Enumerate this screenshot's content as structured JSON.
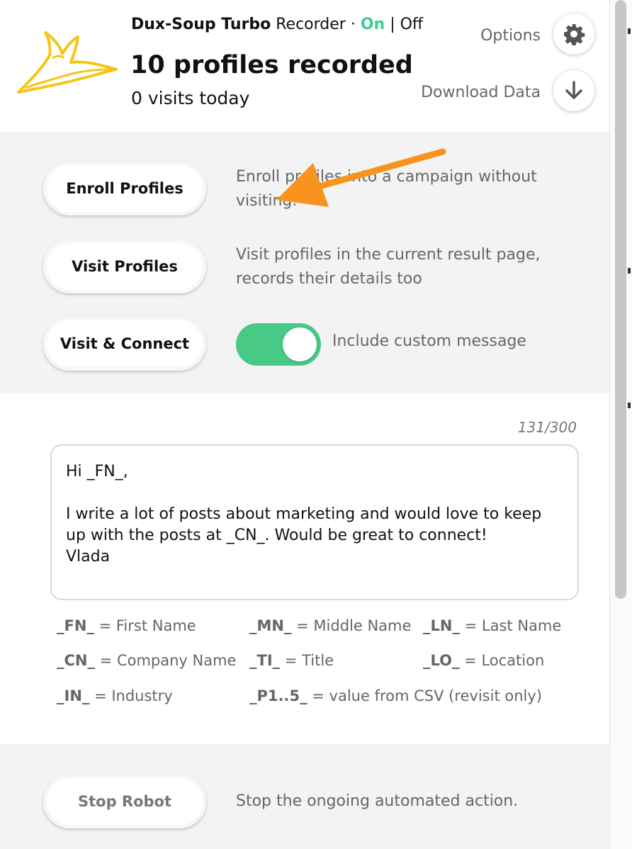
{
  "header": {
    "brand_name": "Dux-Soup Turbo",
    "brand_suffix": " Recorder · ",
    "on_label": "On",
    "separator": " | ",
    "off_label": "Off",
    "title": "10 profiles recorded",
    "subtitle": "0 visits today",
    "options_label": "Options",
    "download_label": "Download Data"
  },
  "actions": [
    {
      "label": "Enroll Profiles",
      "description": "Enroll profiles into a campaign without visiting."
    },
    {
      "label": "Visit Profiles",
      "description": "Visit profiles in the current result page, records their details too"
    },
    {
      "label": "Visit & Connect"
    }
  ],
  "toggle": {
    "label": "Include custom message",
    "state": "on"
  },
  "message": {
    "counter": "131/300",
    "text": "Hi _FN_,\n\nI write a lot of posts about marketing and would love to keep up with the posts at _CN_. Would be great to connect!\nVlada"
  },
  "legend": [
    {
      "code": "_FN_",
      "text": " = First Name"
    },
    {
      "code": "_MN_",
      "text": " = Middle Name"
    },
    {
      "code": "_LN_",
      "text": " = Last Name"
    },
    {
      "code": "_CN_",
      "text": " = Company Name"
    },
    {
      "code": "_TI_",
      "text": " = Title"
    },
    {
      "code": "_LO_",
      "text": " = Location"
    },
    {
      "code": "_IN_",
      "text": " = Industry"
    },
    {
      "code": "_P1..5_",
      "text": " = value from CSV (revisit only)"
    }
  ],
  "stop": {
    "label": "Stop Robot",
    "description": "Stop the ongoing automated action."
  },
  "colors": {
    "accent_green": "#3ecf8e",
    "toggle_green": "#48c986",
    "logo_yellow": "#f5c518",
    "annotation_orange": "#f7931e"
  },
  "icons": {
    "options": "gear-icon",
    "download": "download-arrow-icon",
    "logo": "dux-soup-bird-logo",
    "annotation": "orange-arrow-annotation"
  }
}
